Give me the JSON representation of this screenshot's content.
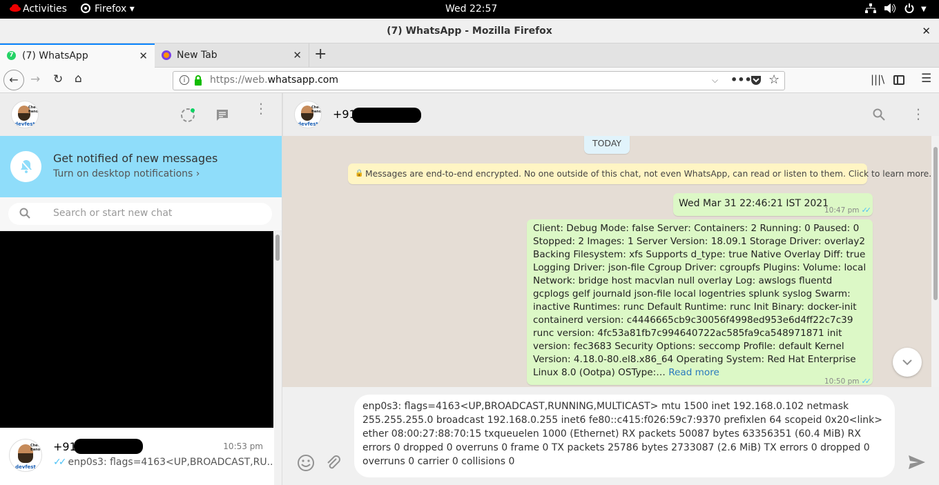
{
  "system": {
    "activities": "Activities",
    "app_menu": "Firefox ▾",
    "clock": "Wed 22:57"
  },
  "window": {
    "title": "(7) WhatsApp - Mozilla Firefox",
    "close": "✕"
  },
  "tabs": [
    {
      "label": "(7) WhatsApp",
      "close": "✕"
    },
    {
      "label": "New Tab",
      "close": "✕"
    }
  ],
  "new_tab": "+",
  "url": {
    "prefix": "https://web.",
    "domain": "whatsapp.com"
  },
  "left": {
    "notification": {
      "title": "Get notified of new messages",
      "subtitle": "Turn on desktop notifications ›"
    },
    "search_placeholder": "Search or start new chat",
    "chat": {
      "name_prefix": "+91",
      "time": "10:53 pm",
      "preview": "enp0s3: flags=4163<UP,BROADCAST,RU..."
    }
  },
  "right": {
    "contact_prefix": "+91",
    "date_label": "TODAY",
    "encryption_notice": "Messages are end-to-end encrypted. No one outside of this chat, not even WhatsApp, can read or listen to them. Click to learn more.",
    "messages": [
      {
        "text": "Wed Mar 31 22:46:21 IST 2021",
        "time": "10:47 pm"
      },
      {
        "text": "Client: Debug Mode: false Server: Containers: 2 Running: 0 Paused: 0 Stopped: 2 Images: 1 Server Version: 18.09.1 Storage Driver: overlay2 Backing Filesystem: xfs Supports d_type: true Native Overlay Diff: true Logging Driver: json-file Cgroup Driver: cgroupfs Plugins: Volume: local Network: bridge host macvlan null overlay Log: awslogs fluentd gcplogs gelf journald json-file local logentries splunk syslog Swarm: inactive Runtimes: runc Default Runtime: runc Init Binary: docker-init containerd version: c4446665cb9c30056f4998ed953e6d4ff22c7c39 runc version: 4fc53a81fb7c994640722ac585fa9ca548971871 init version: fec3683 Security Options: seccomp Profile: default Kernel Version: 4.18.0-80.el8.x86_64 Operating System: Red Hat Enterprise Linux 8.0 (Ootpa) OSType:…",
        "read_more": "Read more",
        "time": "10:50 pm"
      }
    ],
    "compose_text": "enp0s3: flags=4163<UP,BROADCAST,RUNNING,MULTICAST> mtu 1500 inet 192.168.0.102 netmask 255.255.255.0 broadcast 192.168.0.255 inet6 fe80::c415:f026:59c7:9370 prefixlen 64 scopeid 0x20<link> ether 08:00:27:88:70:15 txqueuelen 1000 (Ethernet) RX packets 50087 bytes 63356351 (60.4 MiB) RX errors 0 dropped 0 overruns 0 frame 0 TX packets 25786 bytes 2733087 (2.6 MiB) TX errors 0 dropped 0 overruns 0 carrier 0 collisions 0"
  },
  "colors": {
    "notification_bg": "#8fddfa",
    "outgoing_bubble": "#dcf8c6",
    "chat_bg": "#e5ddd5",
    "read_ticks": "#4fc3f7",
    "tab_accent": "#0a84ff"
  }
}
